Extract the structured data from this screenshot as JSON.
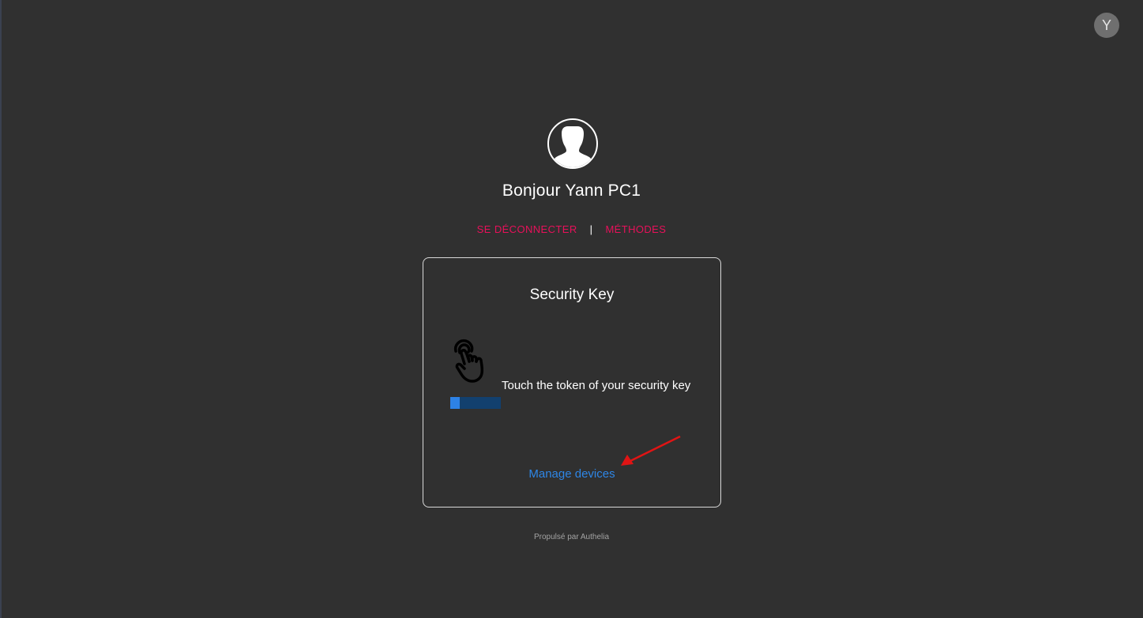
{
  "header": {
    "account_initial": "Y"
  },
  "profile": {
    "icon": "user-silhouette-icon"
  },
  "greeting": "Bonjour Yann PC1",
  "nav": {
    "logout_label": "SE DÉCONNECTER",
    "separator": "|",
    "methods_label": "MÉTHODES"
  },
  "card": {
    "title": "Security Key",
    "instruction": "Touch the token of your security key",
    "icon": "touch-hand-icon",
    "progress_fraction": 0.18,
    "manage_label": "Manage devices"
  },
  "annotation": {
    "arrow_color": "#e01414"
  },
  "footer": "Propulsé par Authelia",
  "colors": {
    "background": "#303030",
    "accent_link": "#e8105a",
    "primary": "#2d82e6"
  }
}
